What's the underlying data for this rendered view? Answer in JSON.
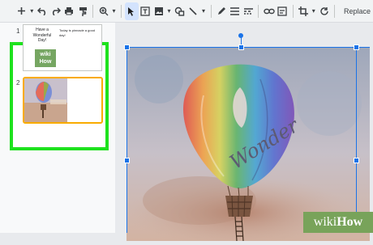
{
  "toolbar": {
    "replace_label": "Replace",
    "icons": [
      "add-icon",
      "dropdown-icon",
      "undo-icon",
      "redo-icon",
      "print-icon",
      "paint-format-icon",
      "zoom-icon",
      "dropdown-icon",
      "select-icon",
      "text-box-icon",
      "image-icon",
      "shape-icon",
      "line-icon",
      "dropdown-icon",
      "pen-icon",
      "border-weight-icon",
      "border-dash-icon",
      "link-icon",
      "alt-text-icon",
      "crop-icon",
      "dropdown-icon",
      "reset-image-icon"
    ]
  },
  "filmstrip": {
    "slides": [
      {
        "number": "1",
        "title": "Have a Wonderful Day!",
        "body": "Today is pinnacle a good day!",
        "logo_line1": "wiki",
        "logo_line2": "How"
      },
      {
        "number": "2"
      }
    ],
    "highlight_color": "#1ee21e",
    "selected_color": "#f9ab00"
  },
  "slide_image": {
    "lettering": "Wonder"
  },
  "watermark": {
    "part1": "wiki",
    "part2": "How",
    "color": "#78a35a"
  },
  "selection_color": "#1a73e8"
}
